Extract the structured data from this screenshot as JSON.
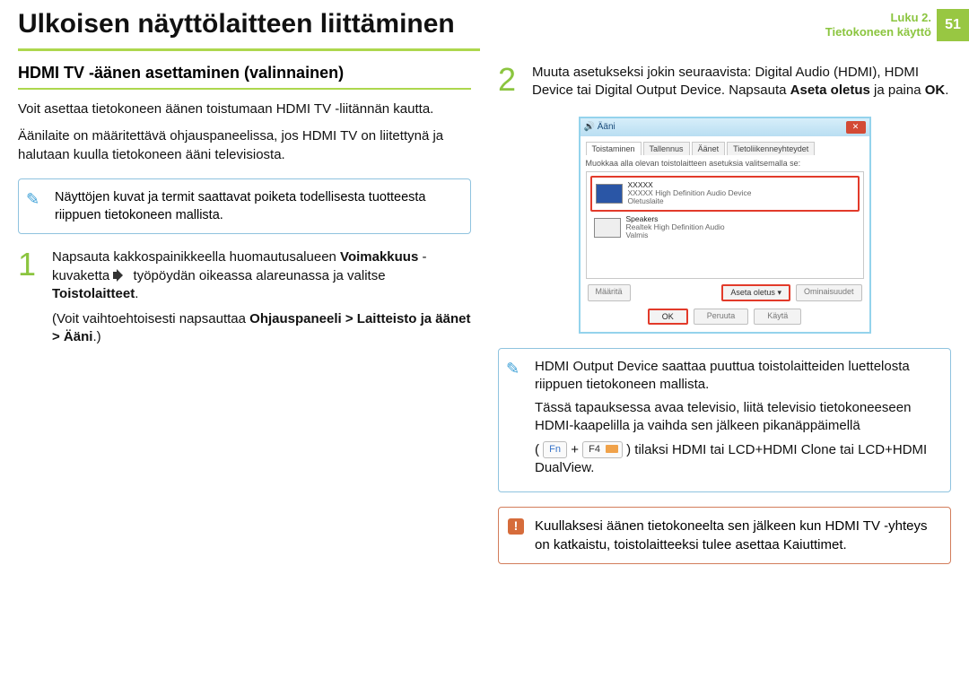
{
  "header": {
    "title": "Ulkoisen näyttölaitteen liittäminen",
    "chapter_line1": "Luku 2.",
    "chapter_line2": "Tietokoneen käyttö",
    "page_number": "51"
  },
  "left": {
    "section_title": "HDMI TV -äänen asettaminen (valinnainen)",
    "intro1": "Voit asettaa tietokoneen äänen toistumaan HDMI TV -liitännän kautta.",
    "intro2": "Äänilaite on määritettävä ohjauspaneelissa, jos HDMI TV on liitettynä ja halutaan kuulla tietokoneen ääni televisiosta.",
    "note": "Näyttöjen kuvat ja termit saattavat poiketa todellisesta tuotteesta riippuen tietokoneen mallista.",
    "step1": {
      "num": "1",
      "p1a": "Napsauta kakkospainikkeella huomautusalueen ",
      "bold1": "Voimakkuus",
      "p1b": " -kuvaketta ",
      "p1c": " työpöydän oikeassa alareunassa ja valitse ",
      "bold2": "Toistolaitteet",
      "period": ".",
      "p2a": "(Voit vaihtoehtoisesti napsauttaa ",
      "bold3": "Ohjauspaneeli > Laitteisto ja äänet > Ääni",
      "p2b": ".)"
    }
  },
  "right": {
    "step2": {
      "num": "2",
      "p1a": "Muuta asetukseksi jokin seuraavista: Digital Audio (HDMI), HDMI Device tai Digital Output Device. Napsauta ",
      "bold1": "Aseta oletus",
      "p1b": " ja paina ",
      "bold2": "OK",
      "period": "."
    },
    "shot": {
      "win_title": "Ääni",
      "tab_playback": "Toistaminen",
      "tab_record": "Tallennus",
      "tab_sounds": "Äänet",
      "tab_comm": "Tietoliikenneyhteydet",
      "desc": "Muokkaa alla olevan toistolaitteen asetuksia valitsemalla se:",
      "dev1_name": "XXXXX",
      "dev1_sub": "XXXXX High Definition Audio Device",
      "dev1_status": "Oletuslaite",
      "dev2_name": "Speakers",
      "dev2_sub": "Realtek High Definition Audio",
      "dev2_status": "Valmis",
      "btn_config": "Määritä",
      "btn_setdef": "Aseta oletus",
      "btn_props": "Ominaisuudet",
      "btn_ok": "OK",
      "btn_cancel": "Peruuta",
      "btn_apply": "Käytä"
    },
    "note2": {
      "p1": "HDMI Output Device saattaa puuttua toistolaitteiden luettelosta riippuen tietokoneen mallista.",
      "p2": "Tässä tapauksessa avaa televisio, liitä televisio tietokoneeseen HDMI-kaapelilla ja vaihda sen jälkeen pikanäppäimellä",
      "p3a": "(",
      "fn": "Fn",
      "plus": " + ",
      "f4": "F4",
      "p3b": ") tilaksi HDMI tai LCD+HDMI Clone tai LCD+HDMI DualView."
    },
    "alert": "Kuullaksesi äänen tietokoneelta sen jälkeen kun HDMI TV -yhteys on katkaistu, toistolaitteeksi tulee asettaa Kaiuttimet."
  }
}
